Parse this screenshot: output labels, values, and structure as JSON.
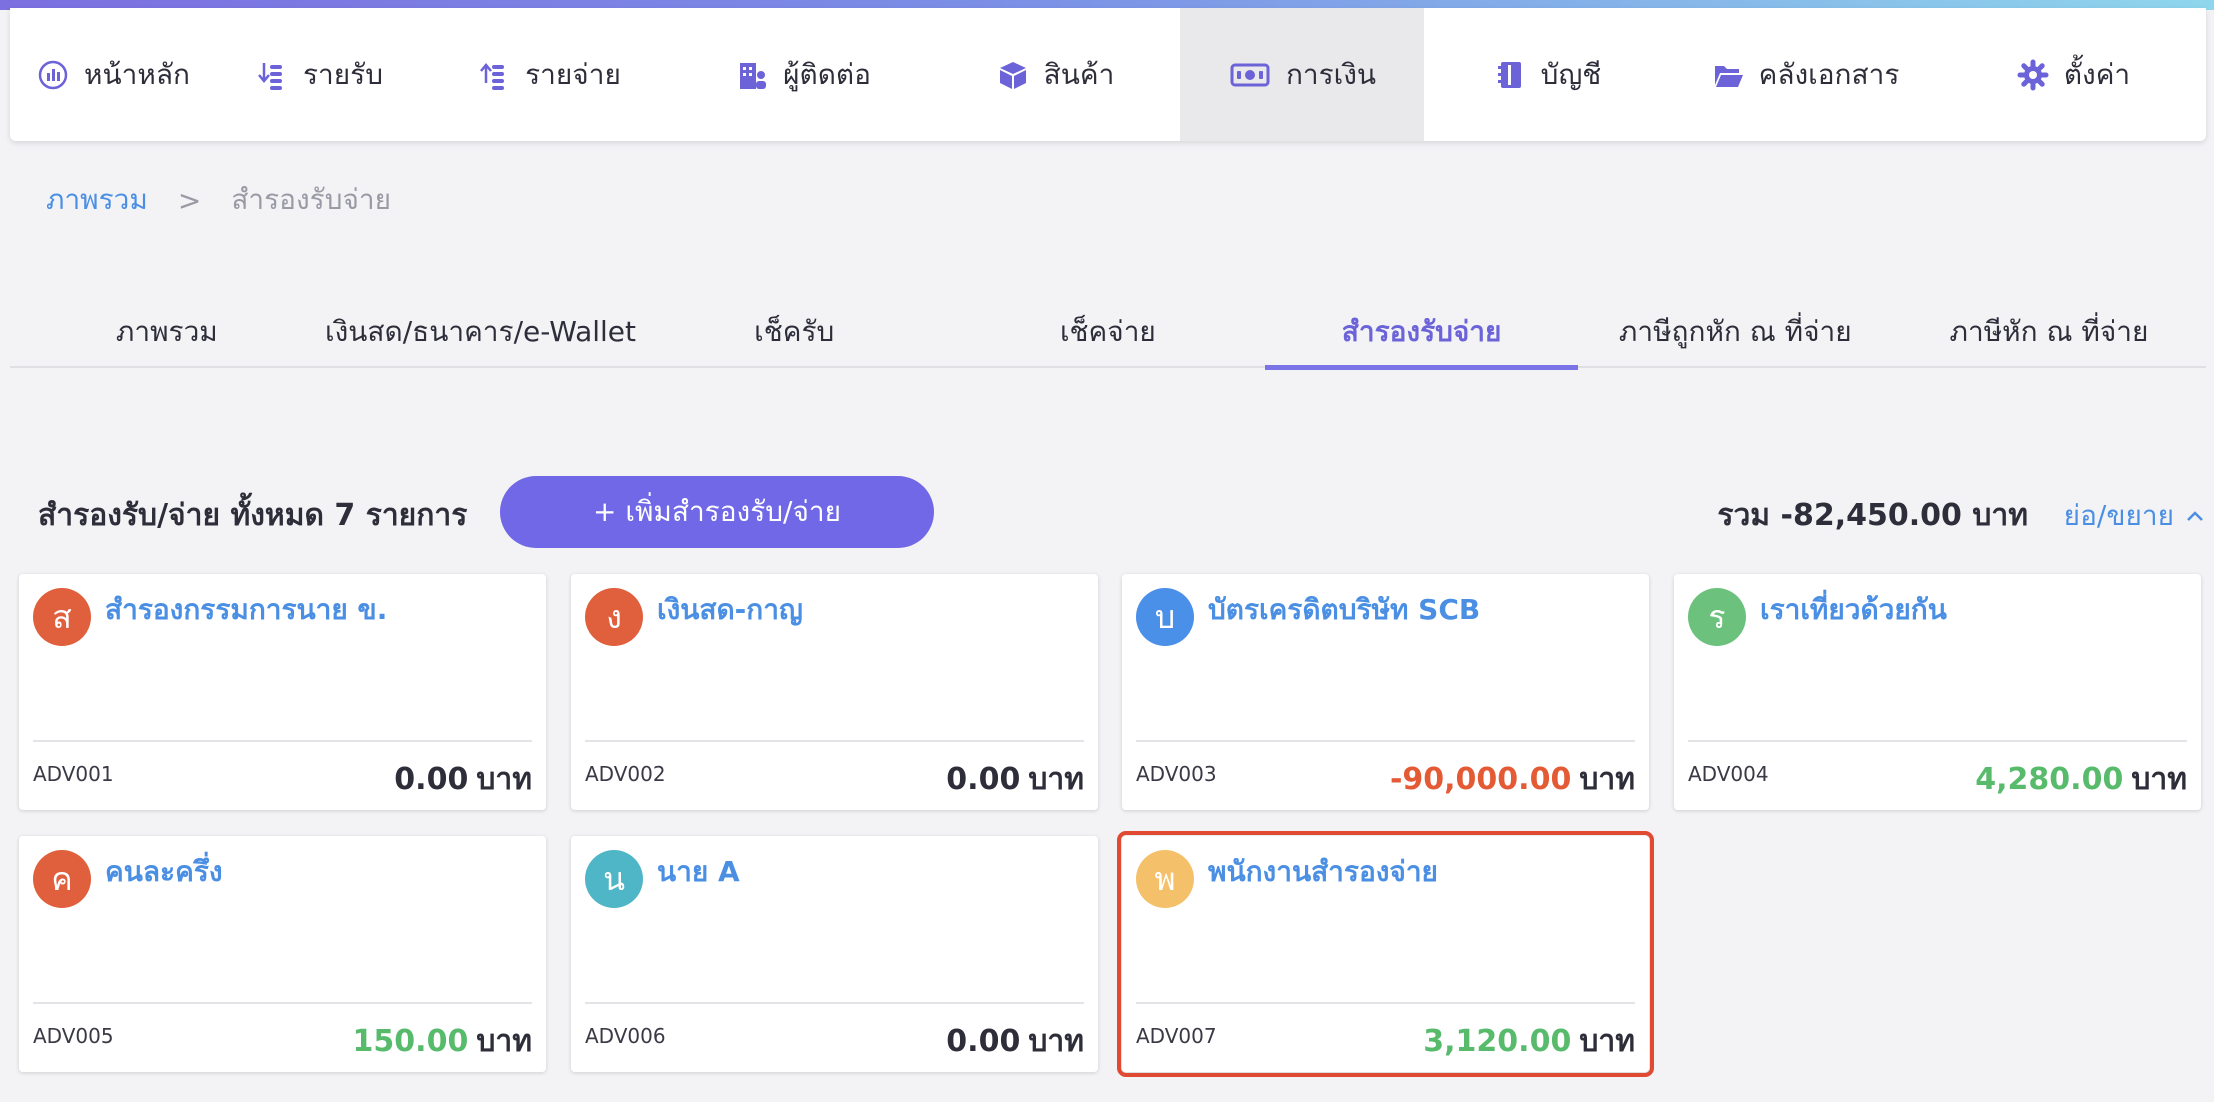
{
  "nav": [
    {
      "label": "หน้าหลัก",
      "icon": "dashboard-icon",
      "active": false
    },
    {
      "label": "รายรับ",
      "icon": "income-icon",
      "active": false
    },
    {
      "label": "รายจ่าย",
      "icon": "expense-icon",
      "active": false
    },
    {
      "label": "ผู้ติดต่อ",
      "icon": "contacts-icon",
      "active": false
    },
    {
      "label": "สินค้า",
      "icon": "box-icon",
      "active": false
    },
    {
      "label": "การเงิน",
      "icon": "money-icon",
      "active": true
    },
    {
      "label": "บัญชี",
      "icon": "ledger-icon",
      "active": false
    },
    {
      "label": "คลังเอกสาร",
      "icon": "folder-icon",
      "active": false
    },
    {
      "label": "ตั้งค่า",
      "icon": "gear-icon",
      "active": false
    }
  ],
  "breadcrumb": {
    "link": "ภาพรวม",
    "separator": ">",
    "current": "สำรองรับจ่าย"
  },
  "tabs": [
    {
      "label": "ภาพรวม",
      "active": false
    },
    {
      "label": "เงินสด/ธนาคาร/e-Wallet",
      "active": false
    },
    {
      "label": "เช็ครับ",
      "active": false
    },
    {
      "label": "เช็คจ่าย",
      "active": false
    },
    {
      "label": "สำรองรับจ่าย",
      "active": true
    },
    {
      "label": "ภาษีถูกหัก ณ ที่จ่าย",
      "active": false
    },
    {
      "label": "ภาษีหัก ณ ที่จ่าย",
      "active": false
    }
  ],
  "section": {
    "title": "สำรองรับ/จ่าย ทั้งหมด 7 รายการ",
    "add_button": "+ เพิ่มสำรองรับ/จ่าย",
    "total": "รวม -82,450.00 บาท",
    "collapse": "ย่อ/ขยาย"
  },
  "colors": {
    "accent": "#7068e6",
    "link": "#4a8fe3",
    "negative": "#e45a35",
    "positive": "#58bb6c",
    "selected_outline": "#e04a32"
  },
  "cards": [
    {
      "initial": "ส",
      "avatar_color": "#e0603d",
      "name": "สำรองกรรมการนาย ข.",
      "code": "ADV001",
      "amount": "0.00",
      "unit": "บาท",
      "sign": "zero"
    },
    {
      "initial": "ง",
      "avatar_color": "#e0603d",
      "name": "เงินสด-กาญ",
      "code": "ADV002",
      "amount": "0.00",
      "unit": "บาท",
      "sign": "zero"
    },
    {
      "initial": "บ",
      "avatar_color": "#4a8fe8",
      "name": "บัตรเครดิตบริษัท SCB",
      "code": "ADV003",
      "amount": "-90,000.00",
      "unit": "บาท",
      "sign": "neg"
    },
    {
      "initial": "ร",
      "avatar_color": "#6cc27c",
      "name": "เราเที่ยวด้วยกัน",
      "code": "ADV004",
      "amount": "4,280.00",
      "unit": "บาท",
      "sign": "pos"
    },
    {
      "initial": "ค",
      "avatar_color": "#e0603d",
      "name": "คนละครึ่ง",
      "code": "ADV005",
      "amount": "150.00",
      "unit": "บาท",
      "sign": "pos"
    },
    {
      "initial": "น",
      "avatar_color": "#4fb6c8",
      "name": "นาย A",
      "code": "ADV006",
      "amount": "0.00",
      "unit": "บาท",
      "sign": "zero"
    },
    {
      "initial": "พ",
      "avatar_color": "#f4c06a",
      "name": "พนักงานสำรองจ่าย",
      "code": "ADV007",
      "amount": "3,120.00",
      "unit": "บาท",
      "sign": "pos",
      "selected": true
    }
  ]
}
